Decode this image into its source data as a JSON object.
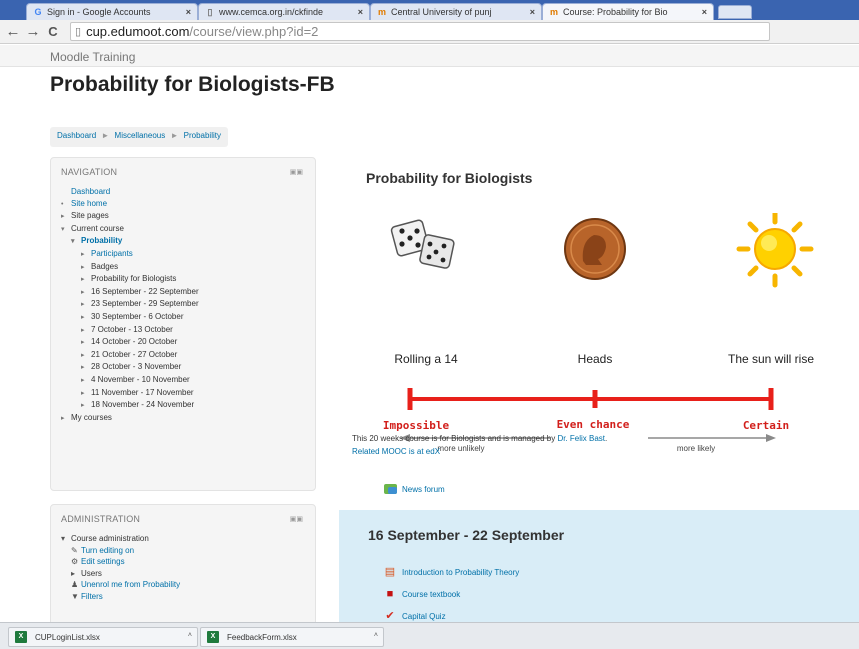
{
  "browser": {
    "tabs": [
      {
        "icon": "G",
        "label": "Sign in - Google Accounts",
        "active": false
      },
      {
        "icon": "▯",
        "label": "www.cemca.org.in/ckfinde",
        "active": false
      },
      {
        "icon": "m",
        "label": "Central University of punj",
        "active": false
      },
      {
        "icon": "m",
        "label": "Course: Probability for Bio",
        "active": true
      }
    ],
    "close_glyph": "×",
    "back_glyph": "←",
    "forward_glyph": "→",
    "reload_glyph": "C",
    "url_host": "cup.edumoot.com",
    "url_path": "/course/view.php?id=2"
  },
  "site": {
    "name": "Moodle Training",
    "course_title": "Probability for Biologists-FB",
    "breadcrumb": [
      "Dashboard",
      "Miscellaneous",
      "Probability"
    ],
    "breadcrumb_sep": "►"
  },
  "navigation": {
    "title": "NAVIGATION",
    "items": [
      {
        "mark": "",
        "label": "Dashboard"
      },
      {
        "mark": "•",
        "label": "Site home"
      },
      {
        "mark": "▸",
        "label": "Site pages"
      },
      {
        "mark": "▾",
        "label": "Current course"
      },
      {
        "mark": "▾",
        "label": "Probability"
      },
      {
        "mark": "▸",
        "label": "Participants"
      },
      {
        "mark": "▸",
        "label": "Badges"
      },
      {
        "mark": "▸",
        "label": "Probability for Biologists"
      },
      {
        "mark": "▸",
        "label": "16 September - 22 September"
      },
      {
        "mark": "▸",
        "label": "23 September - 29 September"
      },
      {
        "mark": "▸",
        "label": "30 September - 6 October"
      },
      {
        "mark": "▸",
        "label": "7 October - 13 October"
      },
      {
        "mark": "▸",
        "label": "14 October - 20 October"
      },
      {
        "mark": "▸",
        "label": "21 October - 27 October"
      },
      {
        "mark": "▸",
        "label": "28 October - 3 November"
      },
      {
        "mark": "▸",
        "label": "4 November - 10 November"
      },
      {
        "mark": "▸",
        "label": "11 November - 17 November"
      },
      {
        "mark": "▸",
        "label": "18 November - 24 November"
      },
      {
        "mark": "▸",
        "label": "My courses"
      }
    ]
  },
  "administration": {
    "title": "ADMINISTRATION",
    "items": [
      {
        "icon": "▾",
        "label": "Course administration"
      },
      {
        "icon": "✎",
        "label": "Turn editing on"
      },
      {
        "icon": "⚙",
        "label": "Edit settings"
      },
      {
        "icon": "▸",
        "label": "Users"
      },
      {
        "icon": "♟",
        "label": "Unenrol me from Probability"
      },
      {
        "icon": "▼",
        "label": "Filters"
      }
    ]
  },
  "main": {
    "topic_heading": "Probability for Biologists",
    "scale": {
      "pictures": [
        "Rolling a 14",
        "Heads",
        "The sun will rise"
      ],
      "points": [
        "Impossible",
        "Even chance",
        "Certain"
      ],
      "arrows": [
        "more unlikely",
        "more likely"
      ],
      "colors": {
        "line": "#e8201a",
        "text": "#d21f1b",
        "arrow": "#8a8a8a"
      }
    },
    "intro_prefix": "This 20 weeks course is for Biologists and is managed by ",
    "intro_link": "Dr. Felix Bast",
    "intro_suffix": ".",
    "intro_line2": "Related MOOC is at edX",
    "news_forum": "News forum"
  },
  "week": {
    "title": "16 September - 22 September",
    "activities": [
      {
        "icon": "page",
        "label": "Introduction to Probability Theory"
      },
      {
        "icon": "book",
        "label": "Course textbook"
      },
      {
        "icon": "quiz",
        "label": "Capital Quiz"
      }
    ]
  },
  "downloads": {
    "items": [
      {
        "label": "CUPLoginList.xlsx"
      },
      {
        "label": "FeedbackForm.xlsx"
      }
    ],
    "caret": "˄"
  }
}
